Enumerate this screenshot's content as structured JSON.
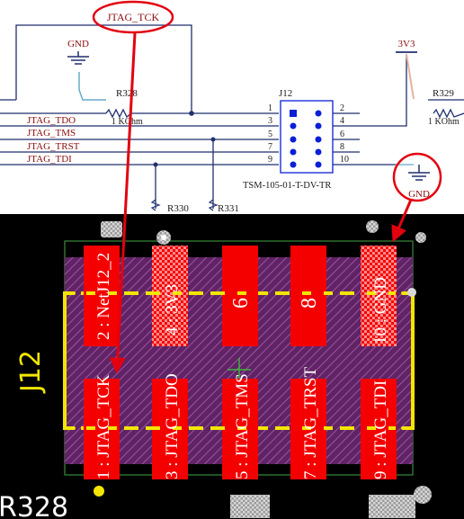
{
  "schematic": {
    "net_tck": "JTAG_TCK",
    "gnd_left": "GND",
    "supply": "3V3",
    "gnd_right": "GND",
    "r328": "R328",
    "r328_value": "1 KOhm",
    "r329": "R329",
    "r329_value": "1 KOhm",
    "r330": "R330",
    "r331": "R331",
    "connector_ref": "J12",
    "connector_part": "TSM-105-01-T-DV-TR",
    "signals": [
      "JTAG_TDO",
      "JTAG_TMS",
      "JTAG_TRST",
      "JTAG_TDI"
    ],
    "left_pins": [
      "1",
      "3",
      "5",
      "7",
      "9"
    ],
    "right_pins": [
      "2",
      "4",
      "6",
      "8",
      "10"
    ]
  },
  "pcb": {
    "designator": "J12",
    "r328_label": "R328",
    "top_pads": [
      "2 : NetJ12_2",
      "4 : 3V3",
      "6",
      "8",
      "10 : GND"
    ],
    "bottom_pads": [
      "1 : JTAG_TCK",
      "3 : JTAG_TDO",
      "5 : JTAG_TMS",
      "7 : JTAG_TRST",
      "9 : JTAG_TDI"
    ]
  },
  "colors": {
    "wire": "#1f2f6e",
    "schematic_text": "#8b0d0d",
    "pin_dot": "#0a1fd6",
    "annotation": "#e3000f",
    "pad": "#f40000",
    "silkscreen": "#f2e600",
    "body_fill": "#6a2a6e",
    "hatch": "#c060c0"
  }
}
